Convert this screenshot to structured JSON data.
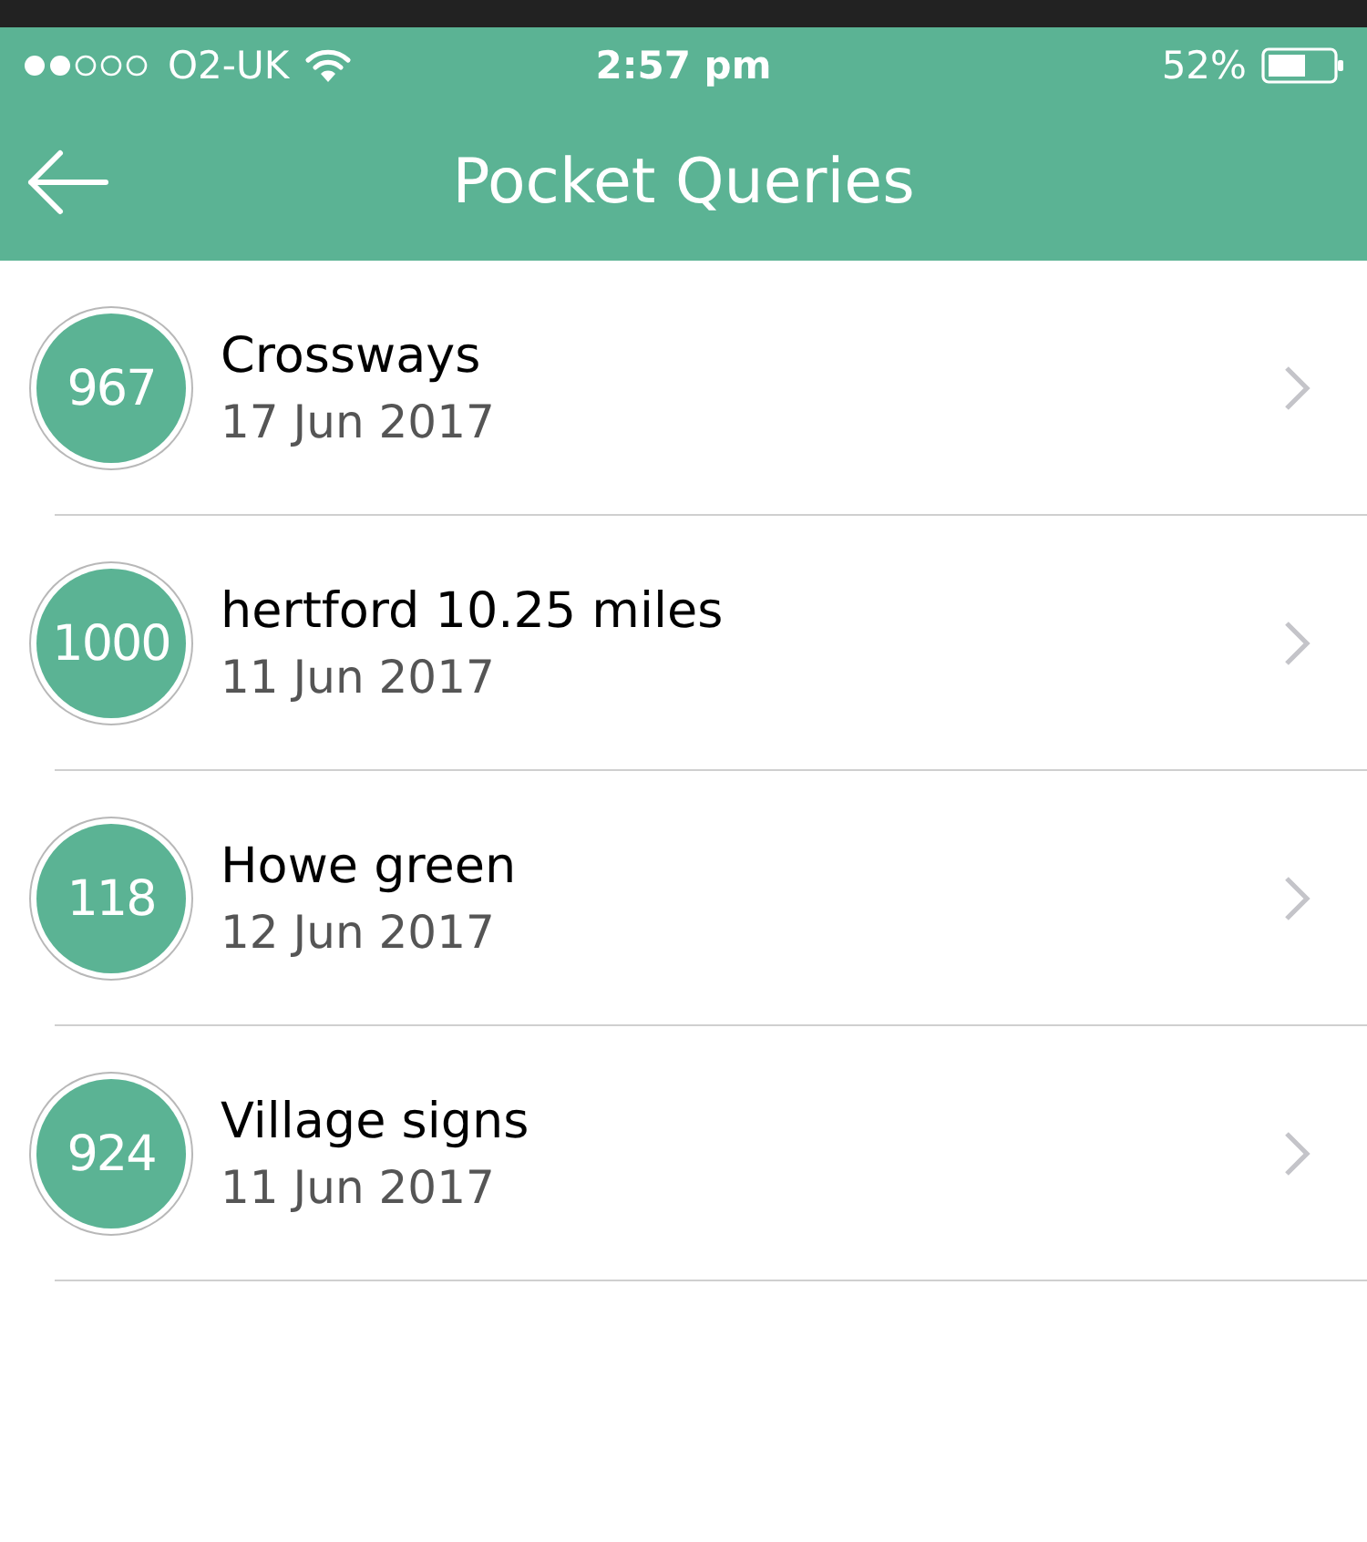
{
  "status_bar": {
    "carrier": "O2-UK",
    "time": "2:57 pm",
    "battery": "52%"
  },
  "nav_bar": {
    "title": "Pocket Queries"
  },
  "queries": [
    {
      "count": "967",
      "name": "Crossways",
      "date": "17 Jun 2017"
    },
    {
      "count": "1000",
      "name": "hertford 10.25 miles",
      "date": "11 Jun 2017"
    },
    {
      "count": "118",
      "name": "Howe green",
      "date": "12 Jun 2017"
    },
    {
      "count": "924",
      "name": "Village signs",
      "date": "11 Jun 2017"
    }
  ]
}
